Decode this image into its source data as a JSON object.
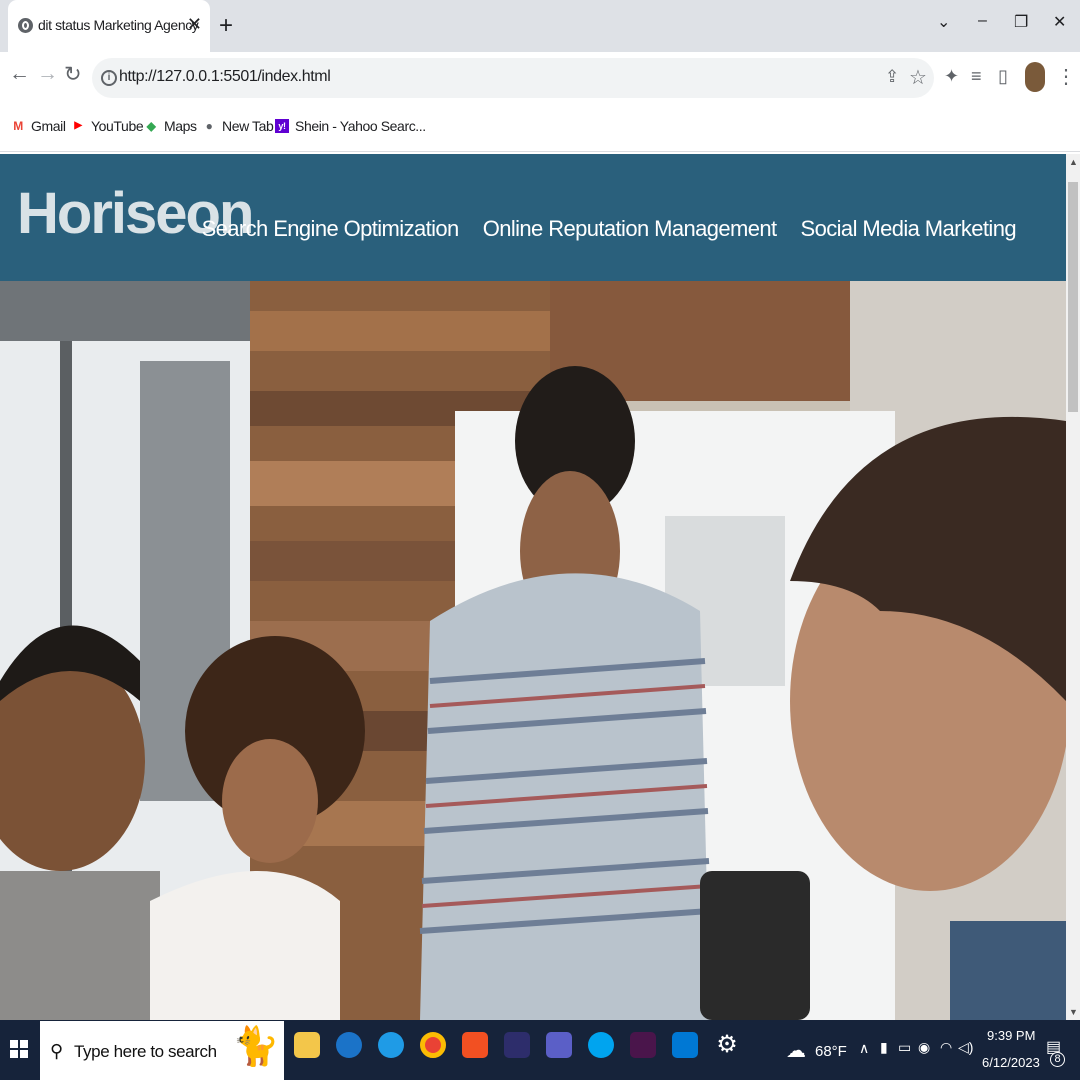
{
  "browser": {
    "tab_title": "dit status Marketing Agency",
    "tab_close": "✕",
    "new_tab": "+",
    "window_controls": {
      "tab_search": "⌄",
      "minimize": "–",
      "restore": "❐",
      "close": "✕"
    },
    "nav": {
      "back": "←",
      "forward": "→",
      "reload": "↻"
    },
    "url": "http://127.0.0.1:5501/index.html",
    "bookmarks": [
      {
        "label": "Gmail",
        "icon": "gmail-icon",
        "color": "#ea4335",
        "glyph": "M"
      },
      {
        "label": "YouTube",
        "icon": "youtube-icon",
        "color": "#ff0000",
        "glyph": "▶"
      },
      {
        "label": "Maps",
        "icon": "maps-icon",
        "color": "#34a853",
        "glyph": "◆"
      },
      {
        "label": "New Tab",
        "icon": "chrome-icon",
        "color": "#5f6368",
        "glyph": "●"
      },
      {
        "label": "Shein - Yahoo Searc...",
        "icon": "yahoo-icon",
        "color": "#6001d2",
        "glyph": "y!"
      }
    ]
  },
  "site": {
    "logo": "Horiseon",
    "nav": [
      "Search Engine Optimization",
      "Online Reputation Management",
      "Social Media Marketing"
    ],
    "header_color": "#2a607c"
  },
  "taskbar": {
    "search_placeholder": "Type here to search",
    "weather": "68°F",
    "time": "9:39 PM",
    "date": "6/12/2023",
    "notifications": "8"
  }
}
